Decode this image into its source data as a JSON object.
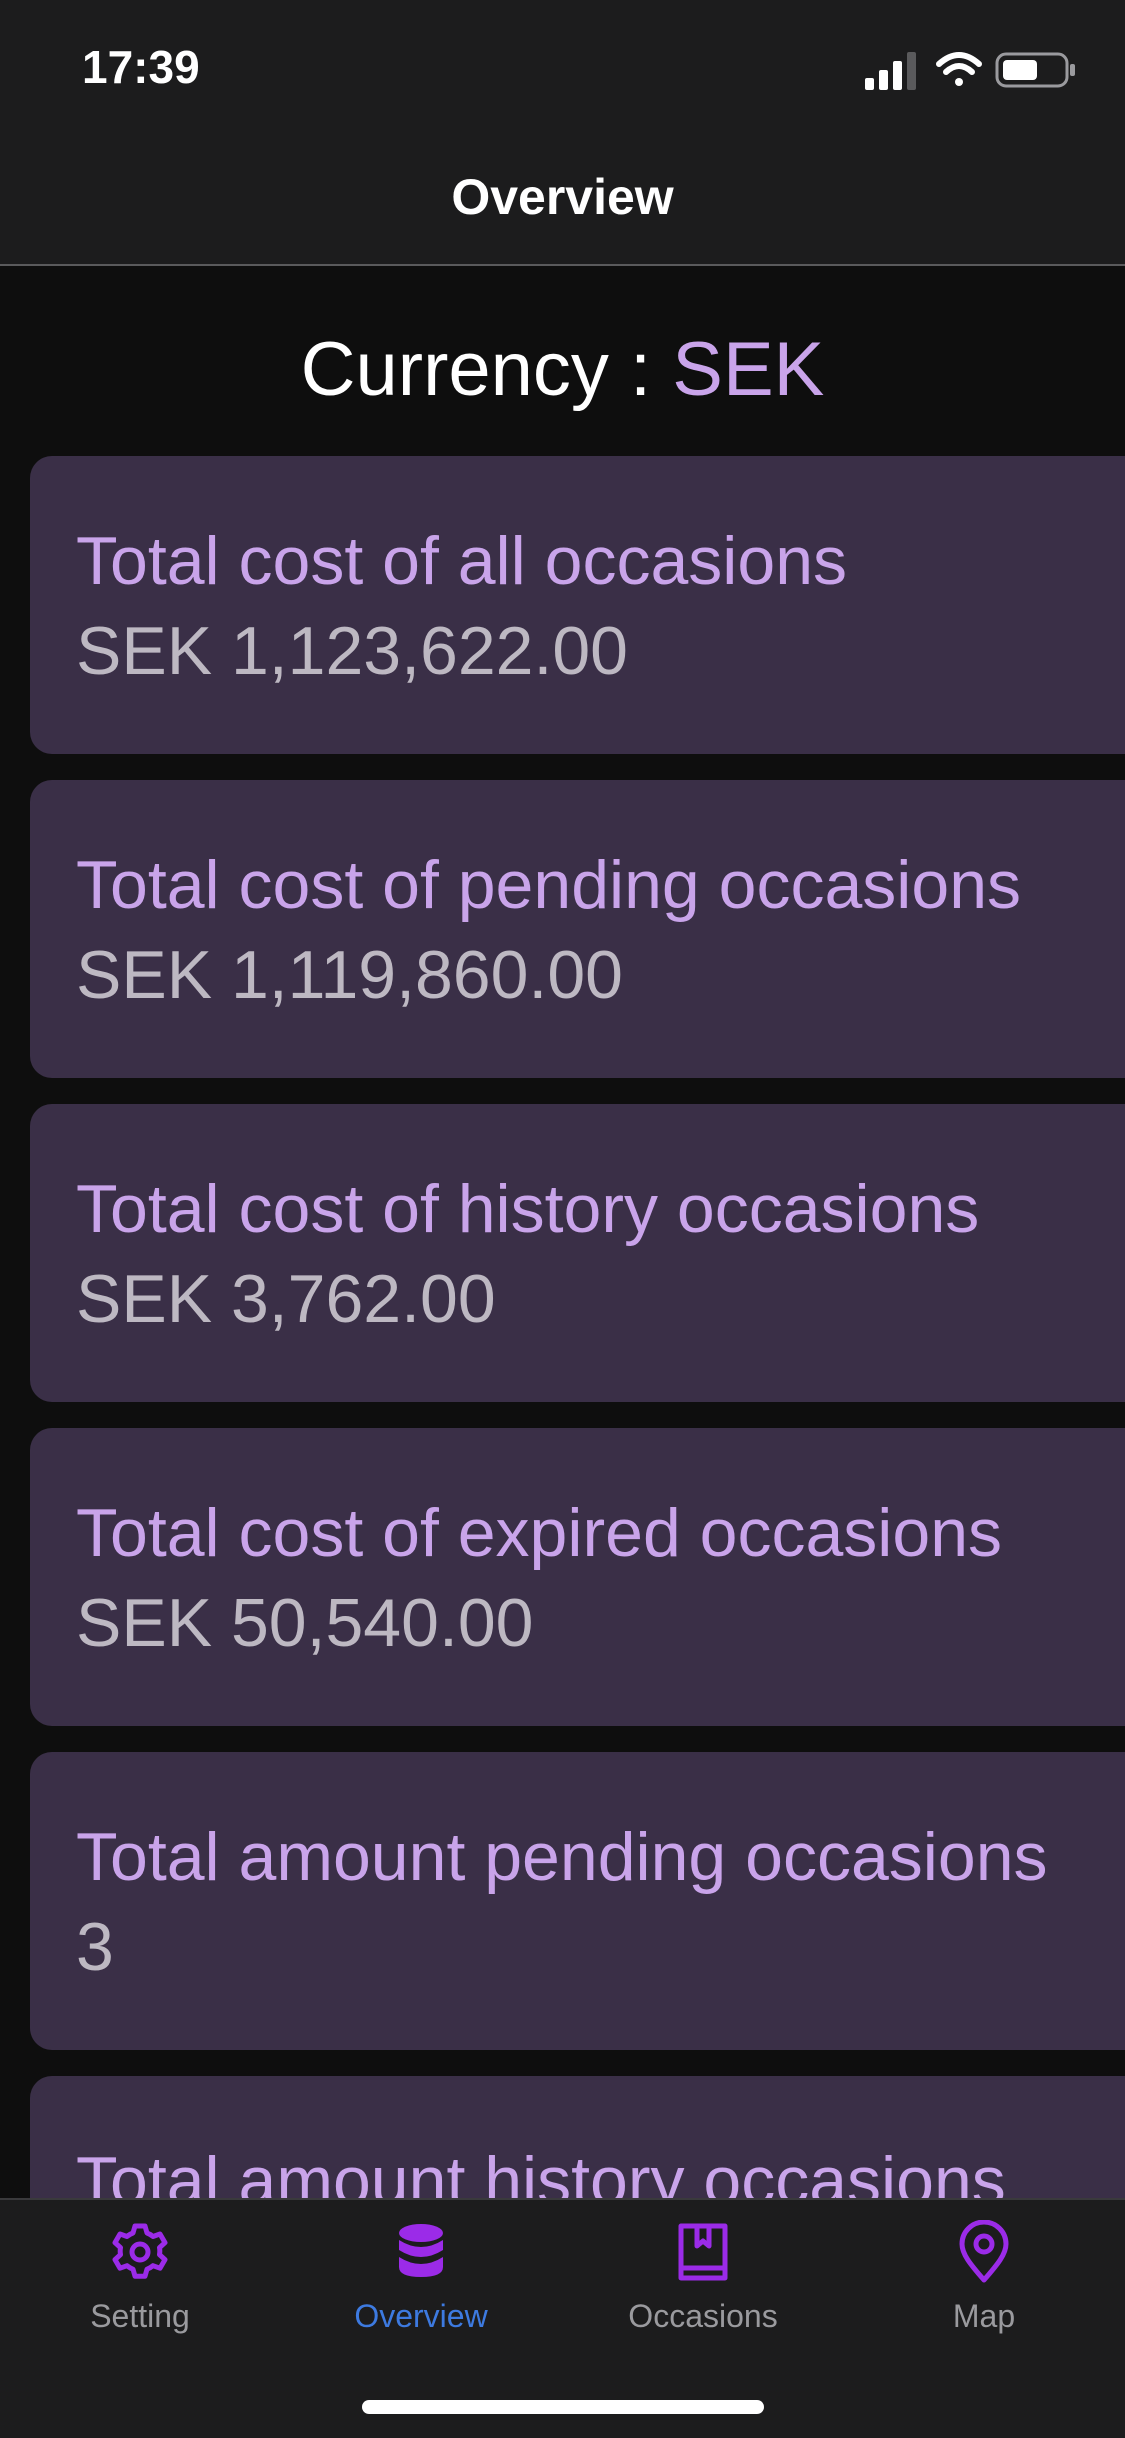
{
  "status": {
    "time": "17:39"
  },
  "nav": {
    "title": "Overview"
  },
  "currency": {
    "label": "Currency : ",
    "value": "SEK"
  },
  "cards": [
    {
      "title": "Total cost of all occasions",
      "value": "SEK 1,123,622.00"
    },
    {
      "title": "Total cost of pending occasions",
      "value": "SEK 1,119,860.00"
    },
    {
      "title": "Total cost of history occasions",
      "value": "SEK 3,762.00"
    },
    {
      "title": "Total cost of expired occasions",
      "value": "SEK 50,540.00"
    },
    {
      "title": "Total amount pending occasions",
      "value": "3"
    },
    {
      "title": "Total amount history occasions",
      "value": ""
    }
  ],
  "tabs": [
    {
      "label": "Setting",
      "icon": "gear-icon"
    },
    {
      "label": "Overview",
      "icon": "database-icon",
      "active": true
    },
    {
      "label": "Occasions",
      "icon": "bookmark-book-icon"
    },
    {
      "label": "Map",
      "icon": "map-pin-icon"
    }
  ],
  "colors": {
    "accent": "#c9a4ea",
    "card": "#3a2f47",
    "tab_icon": "#9b2be8",
    "active_tab": "#3d7ae0"
  }
}
